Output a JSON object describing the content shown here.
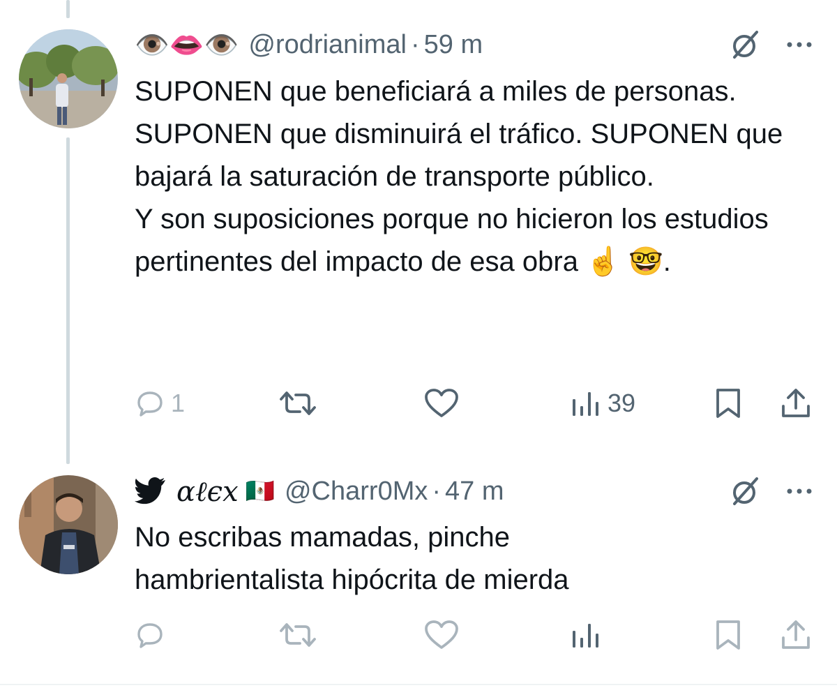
{
  "tweets": [
    {
      "display_name_emojis": "👁️👄👁️",
      "handle": "@rodrianimal",
      "separator": "·",
      "time": "59 m",
      "text": [
        "SUPONEN que beneficiará a miles de personas. SUPONEN que disminuirá el tráfico. SUPONEN que bajará la saturación de transporte público.",
        "Y son suposiciones porque no hicieron los estudios pertinentes del impacto de esa obra ☝️ 🤓."
      ],
      "actions": {
        "reply_count": "1",
        "retweet_count": "",
        "like_count": "",
        "views_count": "39"
      }
    },
    {
      "display_name": "αℓєx",
      "display_name_flag": "🇲🇽",
      "handle": "@Charr0Mx",
      "separator": "·",
      "time": "47 m",
      "text": [
        "No escribas mamadas, pinche hambrientalista hipócrita de mierda"
      ],
      "actions": {
        "reply_count": "",
        "retweet_count": "",
        "like_count": "",
        "views_count": ""
      }
    }
  ],
  "icons": {
    "reply": "speech-bubble-icon",
    "retweet": "retweet-arrows-icon",
    "like": "heart-icon",
    "views": "bar-chart-icon",
    "bookmark": "bookmark-icon",
    "share": "share-upload-icon",
    "grok": "grok-slash-icon",
    "more": "more-dots-icon",
    "bird": "twitter-bird-icon"
  },
  "colors": {
    "text": "#0f1419",
    "secondary": "#536471",
    "faint": "#a9b4bc",
    "thread_line": "#cfd9de"
  }
}
